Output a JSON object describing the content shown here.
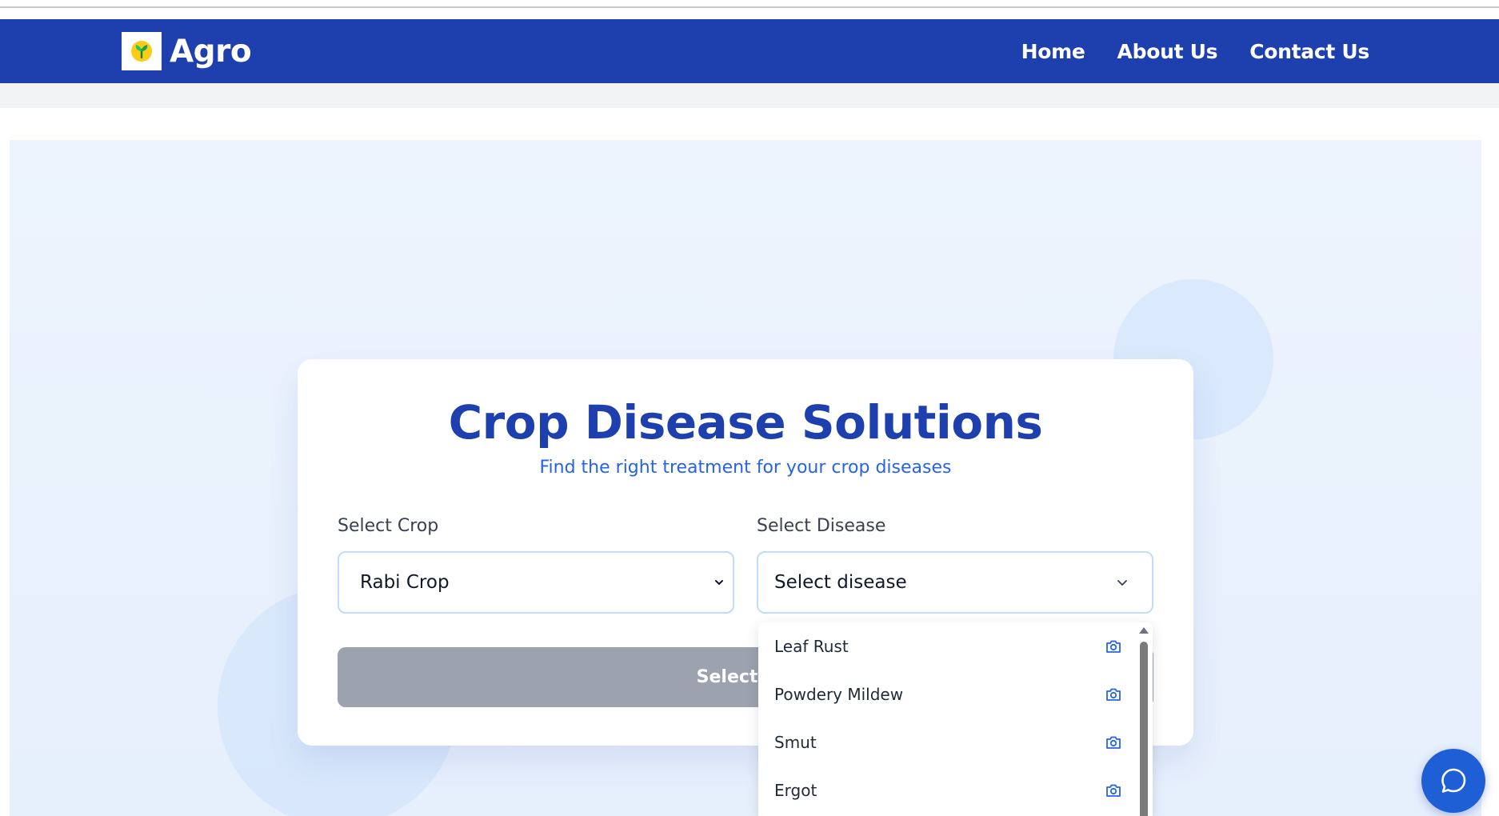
{
  "nav": {
    "brand": "Agro",
    "links": [
      "Home",
      "About Us",
      "Contact Us"
    ]
  },
  "card": {
    "title": "Crop Disease Solutions",
    "subtitle": "Find the right treatment for your crop diseases",
    "crop_label": "Select Crop",
    "crop_value": "Rabi Crop",
    "disease_label": "Select Disease",
    "disease_value": "Select disease",
    "submit_label": "Select a d"
  },
  "dropdown": {
    "options": [
      "Leaf Rust",
      "Powdery Mildew",
      "Smut",
      "Ergot"
    ]
  },
  "icons": {
    "logo": "sprout-icon",
    "option": "camera-icon",
    "chat": "chat-bubble-icon"
  },
  "colors": {
    "brand_blue": "#1e40af",
    "accent_blue": "#2563eb",
    "disabled_gray": "#9ca3af"
  }
}
